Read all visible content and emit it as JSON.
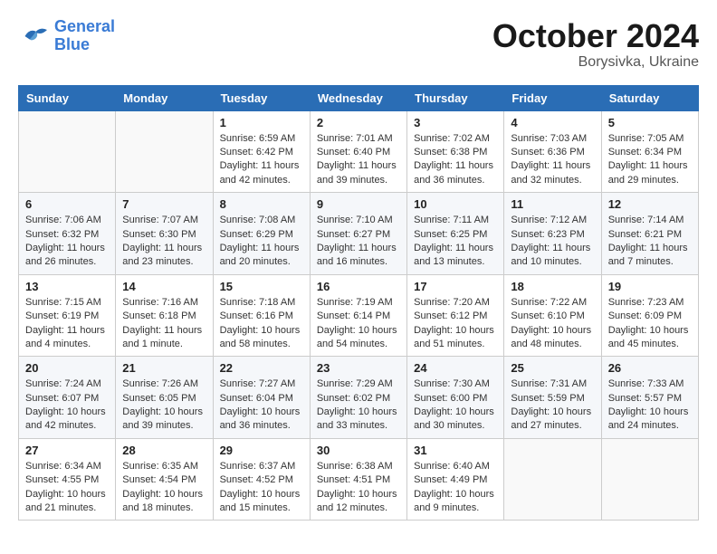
{
  "header": {
    "logo_line1": "General",
    "logo_line2": "Blue",
    "month": "October 2024",
    "location": "Borysivka, Ukraine"
  },
  "weekdays": [
    "Sunday",
    "Monday",
    "Tuesday",
    "Wednesday",
    "Thursday",
    "Friday",
    "Saturday"
  ],
  "weeks": [
    [
      {
        "day": "",
        "empty": true
      },
      {
        "day": "",
        "empty": true
      },
      {
        "day": "1",
        "sunrise": "Sunrise: 6:59 AM",
        "sunset": "Sunset: 6:42 PM",
        "daylight": "Daylight: 11 hours and 42 minutes."
      },
      {
        "day": "2",
        "sunrise": "Sunrise: 7:01 AM",
        "sunset": "Sunset: 6:40 PM",
        "daylight": "Daylight: 11 hours and 39 minutes."
      },
      {
        "day": "3",
        "sunrise": "Sunrise: 7:02 AM",
        "sunset": "Sunset: 6:38 PM",
        "daylight": "Daylight: 11 hours and 36 minutes."
      },
      {
        "day": "4",
        "sunrise": "Sunrise: 7:03 AM",
        "sunset": "Sunset: 6:36 PM",
        "daylight": "Daylight: 11 hours and 32 minutes."
      },
      {
        "day": "5",
        "sunrise": "Sunrise: 7:05 AM",
        "sunset": "Sunset: 6:34 PM",
        "daylight": "Daylight: 11 hours and 29 minutes."
      }
    ],
    [
      {
        "day": "6",
        "sunrise": "Sunrise: 7:06 AM",
        "sunset": "Sunset: 6:32 PM",
        "daylight": "Daylight: 11 hours and 26 minutes."
      },
      {
        "day": "7",
        "sunrise": "Sunrise: 7:07 AM",
        "sunset": "Sunset: 6:30 PM",
        "daylight": "Daylight: 11 hours and 23 minutes."
      },
      {
        "day": "8",
        "sunrise": "Sunrise: 7:08 AM",
        "sunset": "Sunset: 6:29 PM",
        "daylight": "Daylight: 11 hours and 20 minutes."
      },
      {
        "day": "9",
        "sunrise": "Sunrise: 7:10 AM",
        "sunset": "Sunset: 6:27 PM",
        "daylight": "Daylight: 11 hours and 16 minutes."
      },
      {
        "day": "10",
        "sunrise": "Sunrise: 7:11 AM",
        "sunset": "Sunset: 6:25 PM",
        "daylight": "Daylight: 11 hours and 13 minutes."
      },
      {
        "day": "11",
        "sunrise": "Sunrise: 7:12 AM",
        "sunset": "Sunset: 6:23 PM",
        "daylight": "Daylight: 11 hours and 10 minutes."
      },
      {
        "day": "12",
        "sunrise": "Sunrise: 7:14 AM",
        "sunset": "Sunset: 6:21 PM",
        "daylight": "Daylight: 11 hours and 7 minutes."
      }
    ],
    [
      {
        "day": "13",
        "sunrise": "Sunrise: 7:15 AM",
        "sunset": "Sunset: 6:19 PM",
        "daylight": "Daylight: 11 hours and 4 minutes."
      },
      {
        "day": "14",
        "sunrise": "Sunrise: 7:16 AM",
        "sunset": "Sunset: 6:18 PM",
        "daylight": "Daylight: 11 hours and 1 minute."
      },
      {
        "day": "15",
        "sunrise": "Sunrise: 7:18 AM",
        "sunset": "Sunset: 6:16 PM",
        "daylight": "Daylight: 10 hours and 58 minutes."
      },
      {
        "day": "16",
        "sunrise": "Sunrise: 7:19 AM",
        "sunset": "Sunset: 6:14 PM",
        "daylight": "Daylight: 10 hours and 54 minutes."
      },
      {
        "day": "17",
        "sunrise": "Sunrise: 7:20 AM",
        "sunset": "Sunset: 6:12 PM",
        "daylight": "Daylight: 10 hours and 51 minutes."
      },
      {
        "day": "18",
        "sunrise": "Sunrise: 7:22 AM",
        "sunset": "Sunset: 6:10 PM",
        "daylight": "Daylight: 10 hours and 48 minutes."
      },
      {
        "day": "19",
        "sunrise": "Sunrise: 7:23 AM",
        "sunset": "Sunset: 6:09 PM",
        "daylight": "Daylight: 10 hours and 45 minutes."
      }
    ],
    [
      {
        "day": "20",
        "sunrise": "Sunrise: 7:24 AM",
        "sunset": "Sunset: 6:07 PM",
        "daylight": "Daylight: 10 hours and 42 minutes."
      },
      {
        "day": "21",
        "sunrise": "Sunrise: 7:26 AM",
        "sunset": "Sunset: 6:05 PM",
        "daylight": "Daylight: 10 hours and 39 minutes."
      },
      {
        "day": "22",
        "sunrise": "Sunrise: 7:27 AM",
        "sunset": "Sunset: 6:04 PM",
        "daylight": "Daylight: 10 hours and 36 minutes."
      },
      {
        "day": "23",
        "sunrise": "Sunrise: 7:29 AM",
        "sunset": "Sunset: 6:02 PM",
        "daylight": "Daylight: 10 hours and 33 minutes."
      },
      {
        "day": "24",
        "sunrise": "Sunrise: 7:30 AM",
        "sunset": "Sunset: 6:00 PM",
        "daylight": "Daylight: 10 hours and 30 minutes."
      },
      {
        "day": "25",
        "sunrise": "Sunrise: 7:31 AM",
        "sunset": "Sunset: 5:59 PM",
        "daylight": "Daylight: 10 hours and 27 minutes."
      },
      {
        "day": "26",
        "sunrise": "Sunrise: 7:33 AM",
        "sunset": "Sunset: 5:57 PM",
        "daylight": "Daylight: 10 hours and 24 minutes."
      }
    ],
    [
      {
        "day": "27",
        "sunrise": "Sunrise: 6:34 AM",
        "sunset": "Sunset: 4:55 PM",
        "daylight": "Daylight: 10 hours and 21 minutes."
      },
      {
        "day": "28",
        "sunrise": "Sunrise: 6:35 AM",
        "sunset": "Sunset: 4:54 PM",
        "daylight": "Daylight: 10 hours and 18 minutes."
      },
      {
        "day": "29",
        "sunrise": "Sunrise: 6:37 AM",
        "sunset": "Sunset: 4:52 PM",
        "daylight": "Daylight: 10 hours and 15 minutes."
      },
      {
        "day": "30",
        "sunrise": "Sunrise: 6:38 AM",
        "sunset": "Sunset: 4:51 PM",
        "daylight": "Daylight: 10 hours and 12 minutes."
      },
      {
        "day": "31",
        "sunrise": "Sunrise: 6:40 AM",
        "sunset": "Sunset: 4:49 PM",
        "daylight": "Daylight: 10 hours and 9 minutes."
      },
      {
        "day": "",
        "empty": true
      },
      {
        "day": "",
        "empty": true
      }
    ]
  ]
}
